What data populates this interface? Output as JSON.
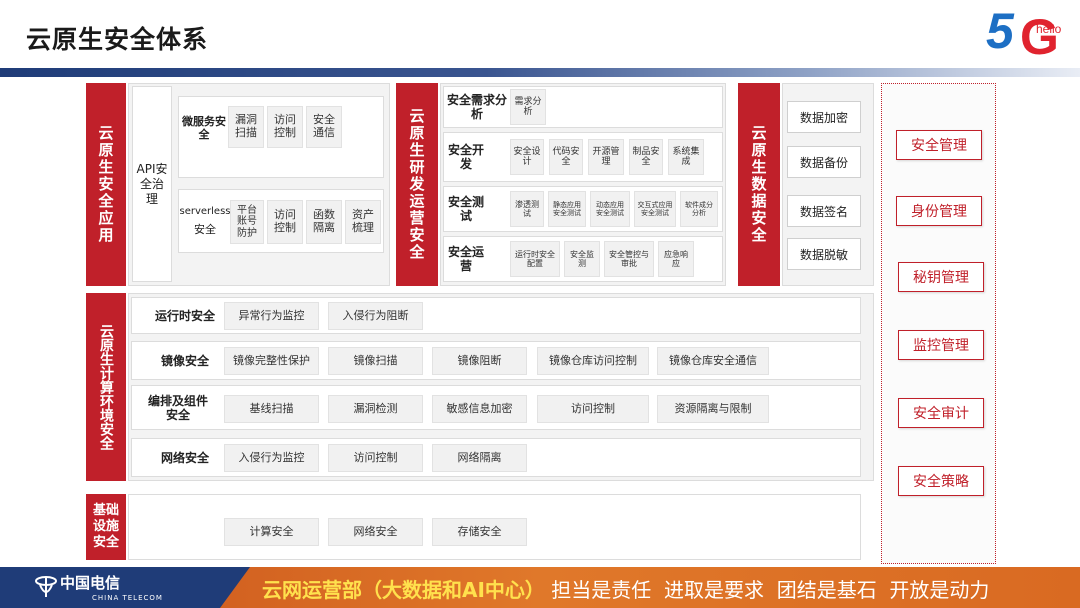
{
  "header": {
    "title": "云原生安全体系",
    "logo_main": "5G",
    "logo_sub": "hello"
  },
  "app_security": {
    "label": "云原生安全应用",
    "api": "API安全治理",
    "microservice": {
      "label": "微服务安全",
      "items": [
        "漏洞扫描",
        "访问控制",
        "安全通信"
      ]
    },
    "serverless": {
      "label_en": "serverless",
      "label": "安全",
      "items": [
        "平台账号防护",
        "访问控制",
        "函数隔离",
        "资产梳理"
      ]
    }
  },
  "devops_security": {
    "label": "云原生研发运营安全",
    "rows": [
      {
        "label": "安全需求分析",
        "items": [
          "需求分析"
        ]
      },
      {
        "label": "安全开发",
        "items": [
          "安全设计",
          "代码安全",
          "开源管理",
          "制品安全",
          "系统集成"
        ]
      },
      {
        "label": "安全测试",
        "items": [
          "渗透测试",
          "静态应用安全测试",
          "动态应用安全测试",
          "交互式应用安全测试",
          "软件成分分析"
        ]
      },
      {
        "label": "安全运营",
        "items": [
          "运行时安全配置",
          "安全监测",
          "安全管控与审批",
          "应急响应"
        ]
      }
    ]
  },
  "data_security": {
    "label": "云原生数据安全",
    "items": [
      "数据加密",
      "数据备份",
      "数据签名",
      "数据脱敏"
    ]
  },
  "compute_security": {
    "label": "云原生计算环境安全",
    "rows": [
      {
        "label": "运行时安全",
        "items": [
          "异常行为监控",
          "入侵行为阻断"
        ]
      },
      {
        "label": "镜像安全",
        "items": [
          "镜像完整性保护",
          "镜像扫描",
          "镜像阻断",
          "镜像仓库访问控制",
          "镜像仓库安全通信"
        ]
      },
      {
        "label": "编排及组件安全",
        "items": [
          "基线扫描",
          "漏洞检测",
          "敏感信息加密",
          "访问控制",
          "资源隔离与限制"
        ]
      },
      {
        "label": "网络安全",
        "items": [
          "入侵行为监控",
          "访问控制",
          "网络隔离"
        ]
      }
    ]
  },
  "infra_security": {
    "label": "基础设施安全",
    "items": [
      "计算安全",
      "网络安全",
      "存储安全"
    ]
  },
  "management": {
    "items": [
      "安全管理",
      "身份管理",
      "秘钥管理",
      "监控管理",
      "安全审计",
      "安全策略"
    ]
  },
  "footer": {
    "brand": "中国电信",
    "brand_en": "CHINA TELECOM",
    "slogan_highlight": "云网运营部（大数据和AI中心）",
    "slogan_rest": "担当是责任  进取是要求  团结是基石  开放是动力"
  },
  "colors": {
    "accent_red": "#c0202a",
    "header_blue": "#1f3c78",
    "footer_orange": "#e0782a"
  }
}
